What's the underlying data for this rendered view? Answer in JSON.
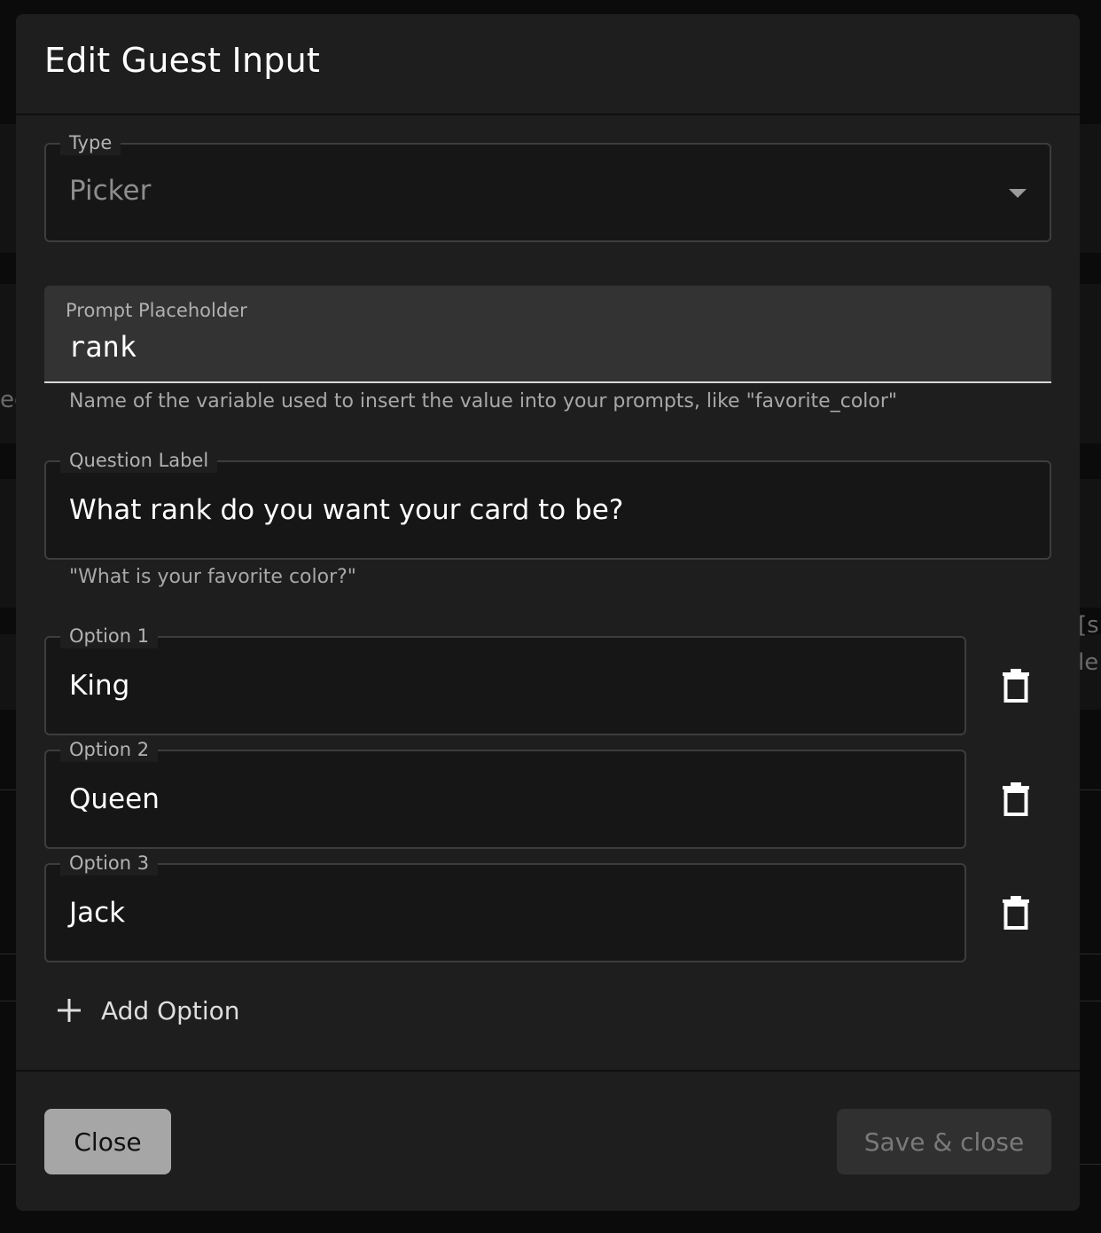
{
  "dialog": {
    "title": "Edit Guest Input"
  },
  "type_field": {
    "label": "Type",
    "value": "Picker"
  },
  "prompt_placeholder": {
    "label": "Prompt Placeholder",
    "value": "rank",
    "helper": "Name of the variable used to insert the value into your prompts, like \"favorite_color\""
  },
  "question_label": {
    "label": "Question Label",
    "value": "What rank do you want your card to be?",
    "helper": "\"What is your favorite color?\""
  },
  "options": [
    {
      "label": "Option 1",
      "value": "King"
    },
    {
      "label": "Option 2",
      "value": "Queen"
    },
    {
      "label": "Option 3",
      "value": "Jack"
    }
  ],
  "add_option_label": "Add Option",
  "footer": {
    "close_label": "Close",
    "save_label": "Save & close"
  },
  "background": {
    "fragments": [
      "eg",
      "[su",
      "le"
    ]
  },
  "icons": {
    "option_delete": "trash-icon",
    "add": "plus-icon",
    "select": "caret-down-icon"
  },
  "colors": {
    "modal_bg": "#1e1e1e",
    "field_bg": "#161616",
    "filled_field_bg": "#333333",
    "close_button_bg": "#a6a6a6",
    "save_button_bg": "#303030"
  }
}
